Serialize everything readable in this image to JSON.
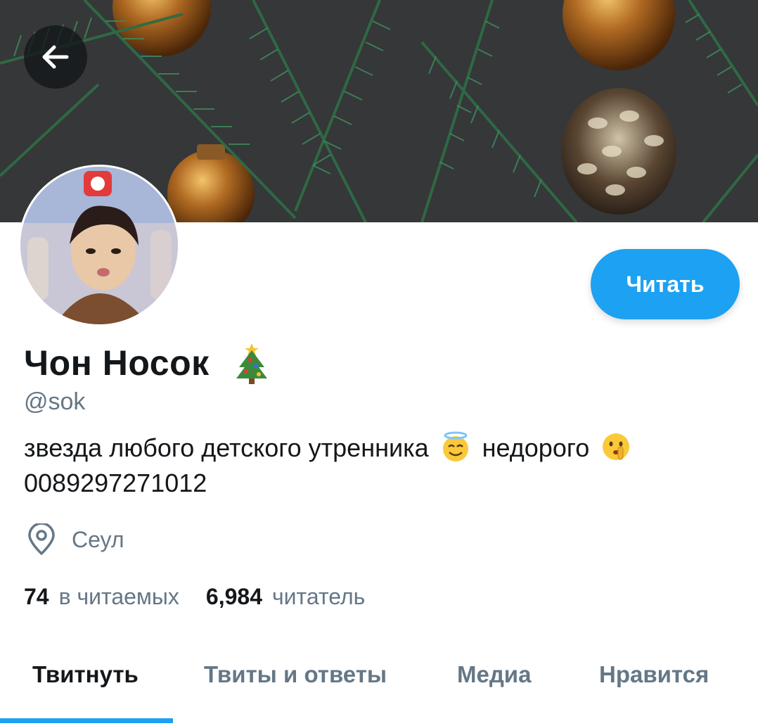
{
  "header": {
    "back_icon": "arrow-left-icon"
  },
  "profile": {
    "follow_label": "Читать",
    "name": "Чон Носок",
    "name_emoji": "christmas-tree-emoji",
    "handle": "@sok",
    "bio_part1": "звезда любого детского утренника",
    "bio_emoji1": "smiling-face-with-halo-emoji",
    "bio_part2": "недорого",
    "bio_emoji2": "shushing-face-emoji",
    "bio_line2": "0089297271012",
    "location": "Сеул",
    "following_count": "74",
    "following_label": "в читаемых",
    "followers_count": "6,984",
    "followers_label": "читатель"
  },
  "tabs": [
    {
      "label": "Твитнуть",
      "active": true
    },
    {
      "label": "Твиты и ответы",
      "active": false
    },
    {
      "label": "Медиа",
      "active": false
    },
    {
      "label": "Нравится",
      "active": false
    }
  ],
  "colors": {
    "accent": "#1da1f2",
    "text": "#14171a",
    "secondary": "#657786"
  }
}
